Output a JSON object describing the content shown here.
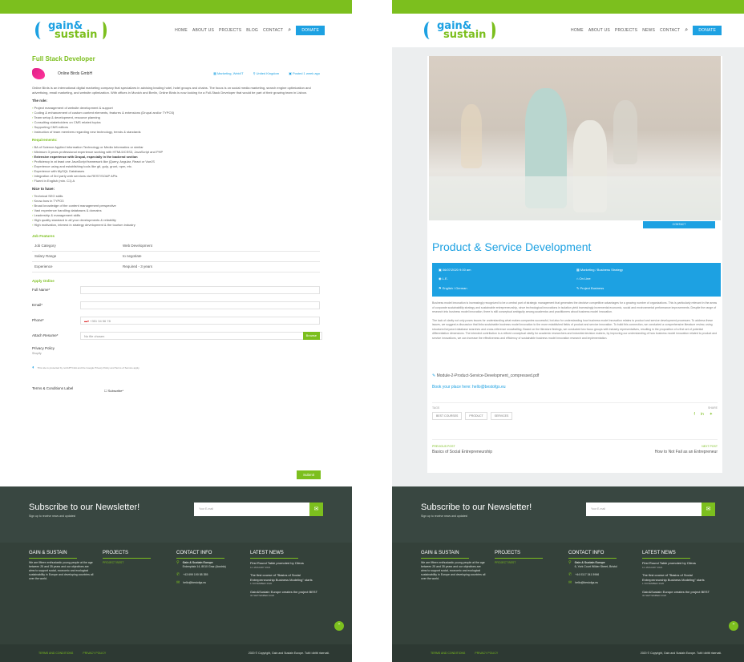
{
  "brand": {
    "line1": "gain&",
    "line2": "sustain",
    "green": "#7cbf1e",
    "blue": "#1da1e2",
    "footer": "#34413a"
  },
  "left": {
    "nav": [
      "HOME",
      "ABOUT US",
      "PROJECTS",
      "BLOG",
      "CONTACT"
    ],
    "donate": "DONATE",
    "job_title": "Full Stack Developer",
    "company": "Online Birds GmbH",
    "meta": [
      "Marketing, Web/IT",
      "United Kingdom",
      "Posted 1 week ago"
    ],
    "intro": "Online Birds is an international digital marketing company that specializes in advising leading hotel, hotel groups and chains. The focus is on social media marketing, search engine optimization and advertising, email marketing, and website optimization. With offices in Munich and Berlin, Online Birds is now looking for a Full-Stack Developer that would be part of their growing team in Lisbon.",
    "role_h": "The role:",
    "role": [
      "Project management of website development & support",
      "Coding & enhancement of custom content elements, features & extensions (Drupal and/or TYPO3)",
      "Team setup & development, resource planning",
      "Consulting stakeholders on CMS related topics",
      "Supporting CMS editors",
      "Instruction of team members regarding new technology, trends & standards"
    ],
    "req_h": "Requirements:",
    "req": [
      "BA of Science Applied Information Technology or Media Informatics or similar",
      "Minimum 3 years professional experience working with HTML5/CSS3, JavaScript and PHP",
      "Extensive experience with Drupal, especially in the backend section",
      "Proficiency in at least one JavaScript framework like jQuery, Angular, React or VueJS",
      "Experience using and establishing tools like git, gulp, grunt, npm, etc.",
      "Experience with MySQL Databases",
      "Integration of 3rd party web services via REST/SOAP APIs",
      "Fluent in English (min. C1) A"
    ],
    "nice_h": "Nice to have:",
    "nice": [
      "Technical SEO skills",
      "Know-how in TYPO3",
      "Broad knowledge of the content management perspective",
      "Vast experience handling databases & domains",
      "Leadership & management skills",
      "High quality standard in all your developments & reliability",
      "High motivation, interest in strategy development & the tourism industry"
    ],
    "features_h": "Job Features",
    "features": [
      [
        "Job Category",
        "Web Development"
      ],
      [
        "Salary Range",
        "to negotiate"
      ],
      [
        "Experience",
        "Required - 3 years"
      ]
    ],
    "apply_h": "Apply Online",
    "fields": {
      "name": "Full Name*",
      "email": "Email*",
      "phone": "Phone*",
      "phone_ph": "+351 34 56 78",
      "resume": "Attach Resume*",
      "nofile": "No file chosen",
      "browse": "Browse",
      "privacy": "Privacy Policy",
      "privacy_sub": "Shopify",
      "captcha": "This site is protected by reCAPTCHA and the Google Privacy Policy and Terms of Service apply.",
      "terms": "Terms & Conditions Label",
      "terms_val": "Subscribe*",
      "submit": "Submit"
    }
  },
  "right": {
    "nav": [
      "HOME",
      "ABOUT US",
      "PROJECTS",
      "NEWS",
      "CONTACT"
    ],
    "donate": "DONATE",
    "more": "CONTACT",
    "title": "Product & Service Development",
    "info": [
      "06/07/2020 9:00 am",
      "Marketing / Business Strategy",
      "L.E.",
      "On Line",
      "English / German",
      "Project Business"
    ],
    "desc1": "Business model innovation is increasingly recognized to be a central part of strategic management that generates the decisive competitive advantages for a growing number of organizations. This is particularly relevant in the areas of corporate sustainability strategy and sustainable entrepreneurship, since technological innovations in isolation yield increasingly incremental economic, social and environmental performance improvements. Despite the range of research into business model innovation, there is still conceptual ambiguity among academics and practitioners about business model innovation.",
    "desc2": "The lack of clarity not only poses issues for understanding what makes companies successful, but also for understanding how business model innovation relates to product and service development processes. To address these issues, we suggest a discussion that links sustainable business model innovation to the more established fields of product and service innovation. To build this connection, we conducted a comprehensive literature review, using structured keyword database searches and cross-reference snowballing. Based on the literature findings, we conducted two focus groups with industry representatives, resulting in the proposition of a first set of potential differentiation dimensions. The intended contribution is a refined conceptual clarity for academic researchers and industrial decision makers, by improving our understanding of how business model innovation related to product and service innovations, we can increase the effectiveness and efficiency of sustainable business model innovation research and implementation.",
    "pdf": "Module-2-Product-Service-Development_compressed.pdf",
    "book": "Book your place here: hello@bestofgs.eu",
    "tags_label": "TAGS",
    "share_label": "SHARE",
    "tags": [
      "BEST COURSES",
      "PRODUCT",
      "SERVICES"
    ],
    "prev_label": "PREVIOUS POST",
    "prev": "Basics of Social Entrepreneurship",
    "next_label": "NEXT POST",
    "next": "How to Not Fail as an Entrepreneur"
  },
  "footer": {
    "nl_title": "Subscribe to our Newsletter!",
    "nl_sub": "Sign up to receive news and updates!",
    "nl_ph": "Your E-mail",
    "c1_h": "GAIN & SUSTAIN",
    "c1": "We are fifteen enthusiastic young people at the age between 25 and 35 years and our objectives are aims to support social, economic and ecological sustainability in Europe and developing countries all over the world.",
    "c2_h": "PROJECTS",
    "c2": "PROJECT BEST",
    "c3_h": "CONTACT INFO",
    "c3_addr_l": "Gain & Sustain Europe",
    "c3_addr_l2": "Erdenplatz 14, 8010 Graz (Austria)",
    "c3_addr_r": "Gain & Sustain Europe",
    "c3_addr_r2": "6, York Court Wilder Street, Bristol",
    "c3_phone_l": "+43 699 190 58 355",
    "c3_phone_r": "+44 0117 341 5966",
    "c3_mail": "hello@bestofgs.eu",
    "c4_h": "LATEST NEWS",
    "news": [
      {
        "t": "First Round Table promoted by Cileos",
        "d": "11 JANUARY 2021"
      },
      {
        "t": "The first course of \"Basics of Social Entrepreneurship Business Modeling\" starts",
        "d": "1 NOVEMBER 2020"
      },
      {
        "t": "Gain&Sustain Europe creates the project BEST",
        "d": "30 SEPTEMBER 2020"
      }
    ],
    "links": [
      "TERMS AND CONDITIONS",
      "PRIVACY POLICY"
    ],
    "copy": "2020 © Copyright, Gain and Sustain Europe. Tutti i diritti riservati."
  }
}
